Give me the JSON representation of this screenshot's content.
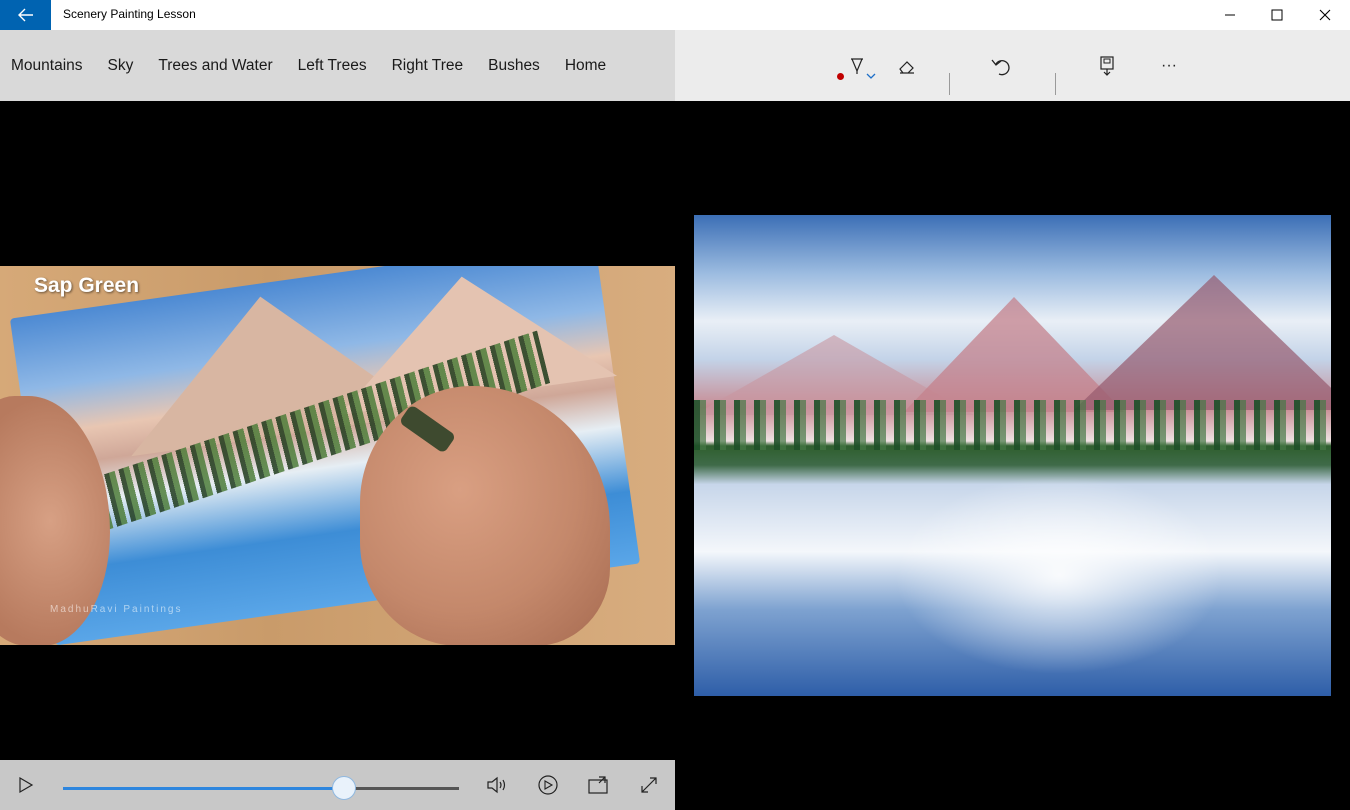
{
  "window": {
    "title": "Scenery Painting Lesson",
    "back_icon": "arrow-left-icon",
    "accent": "#0063b1"
  },
  "nav": {
    "items": [
      {
        "label": "Mountains"
      },
      {
        "label": "Sky"
      },
      {
        "label": "Trees and Water"
      },
      {
        "label": "Left Trees"
      },
      {
        "label": "Right Tree"
      },
      {
        "label": "Bushes"
      },
      {
        "label": "Home"
      }
    ]
  },
  "toolbar": {
    "pen_color": "#c00000",
    "tools": [
      "ballpoint-pen-icon",
      "eraser-icon",
      "undo-icon",
      "save-icon",
      "more-icon"
    ],
    "more_label": "···"
  },
  "video": {
    "caption": "Sap Green",
    "watermark": "MadhuRavi Paintings"
  },
  "player": {
    "progress": 0.71,
    "progress_color": "#2e86de"
  }
}
